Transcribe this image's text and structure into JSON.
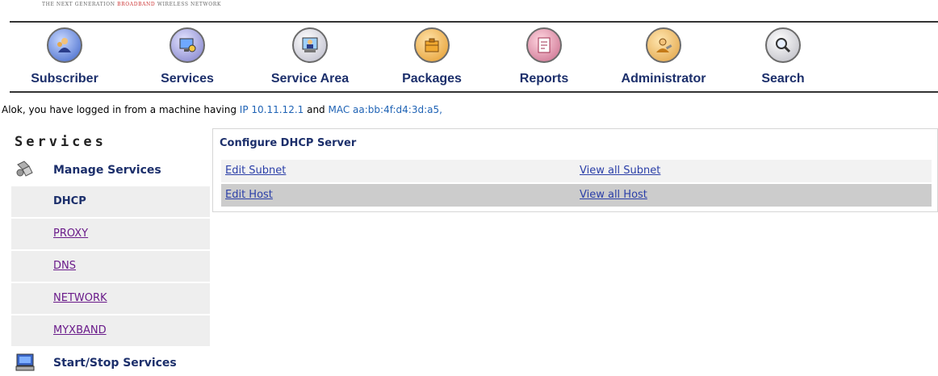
{
  "header": {
    "tagline_pre": "THE NEXT GENERATION ",
    "tagline_em": "BROADBAND",
    "tagline_post": " WIRELESS NETWORK"
  },
  "nav": {
    "items": [
      {
        "label": "Subscriber",
        "icon": "subscriber-icon"
      },
      {
        "label": "Services",
        "icon": "services-icon"
      },
      {
        "label": "Service Area",
        "icon": "service-area-icon"
      },
      {
        "label": "Packages",
        "icon": "packages-icon"
      },
      {
        "label": "Reports",
        "icon": "reports-icon"
      },
      {
        "label": "Administrator",
        "icon": "administrator-icon"
      },
      {
        "label": "Search",
        "icon": "search-icon"
      }
    ]
  },
  "login": {
    "prefix": "Alok, you have logged in from a machine having ",
    "ip": "IP 10.11.12.1",
    "and": " and ",
    "mac": "MAC aa:bb:4f:d4:3d:a5,"
  },
  "sidebar": {
    "title": "Services",
    "manage_label": "Manage Services",
    "items": [
      {
        "label": "DHCP",
        "active": true
      },
      {
        "label": "PROXY",
        "active": false
      },
      {
        "label": "DNS",
        "active": false
      },
      {
        "label": "NETWORK",
        "active": false
      },
      {
        "label": "MYXBAND",
        "active": false
      }
    ],
    "startstop_label": "Start/Stop Services"
  },
  "panel": {
    "title": "Configure DHCP Server",
    "rows": [
      {
        "left": "Edit Subnet",
        "right": "View all Subnet"
      },
      {
        "left": "Edit Host",
        "right": "View all Host"
      }
    ]
  },
  "colors": {
    "nav_text": "#1c2f6b",
    "link_visited": "#6a1b8a",
    "link": "#2b3fa8",
    "info_value": "#1f63b5"
  }
}
